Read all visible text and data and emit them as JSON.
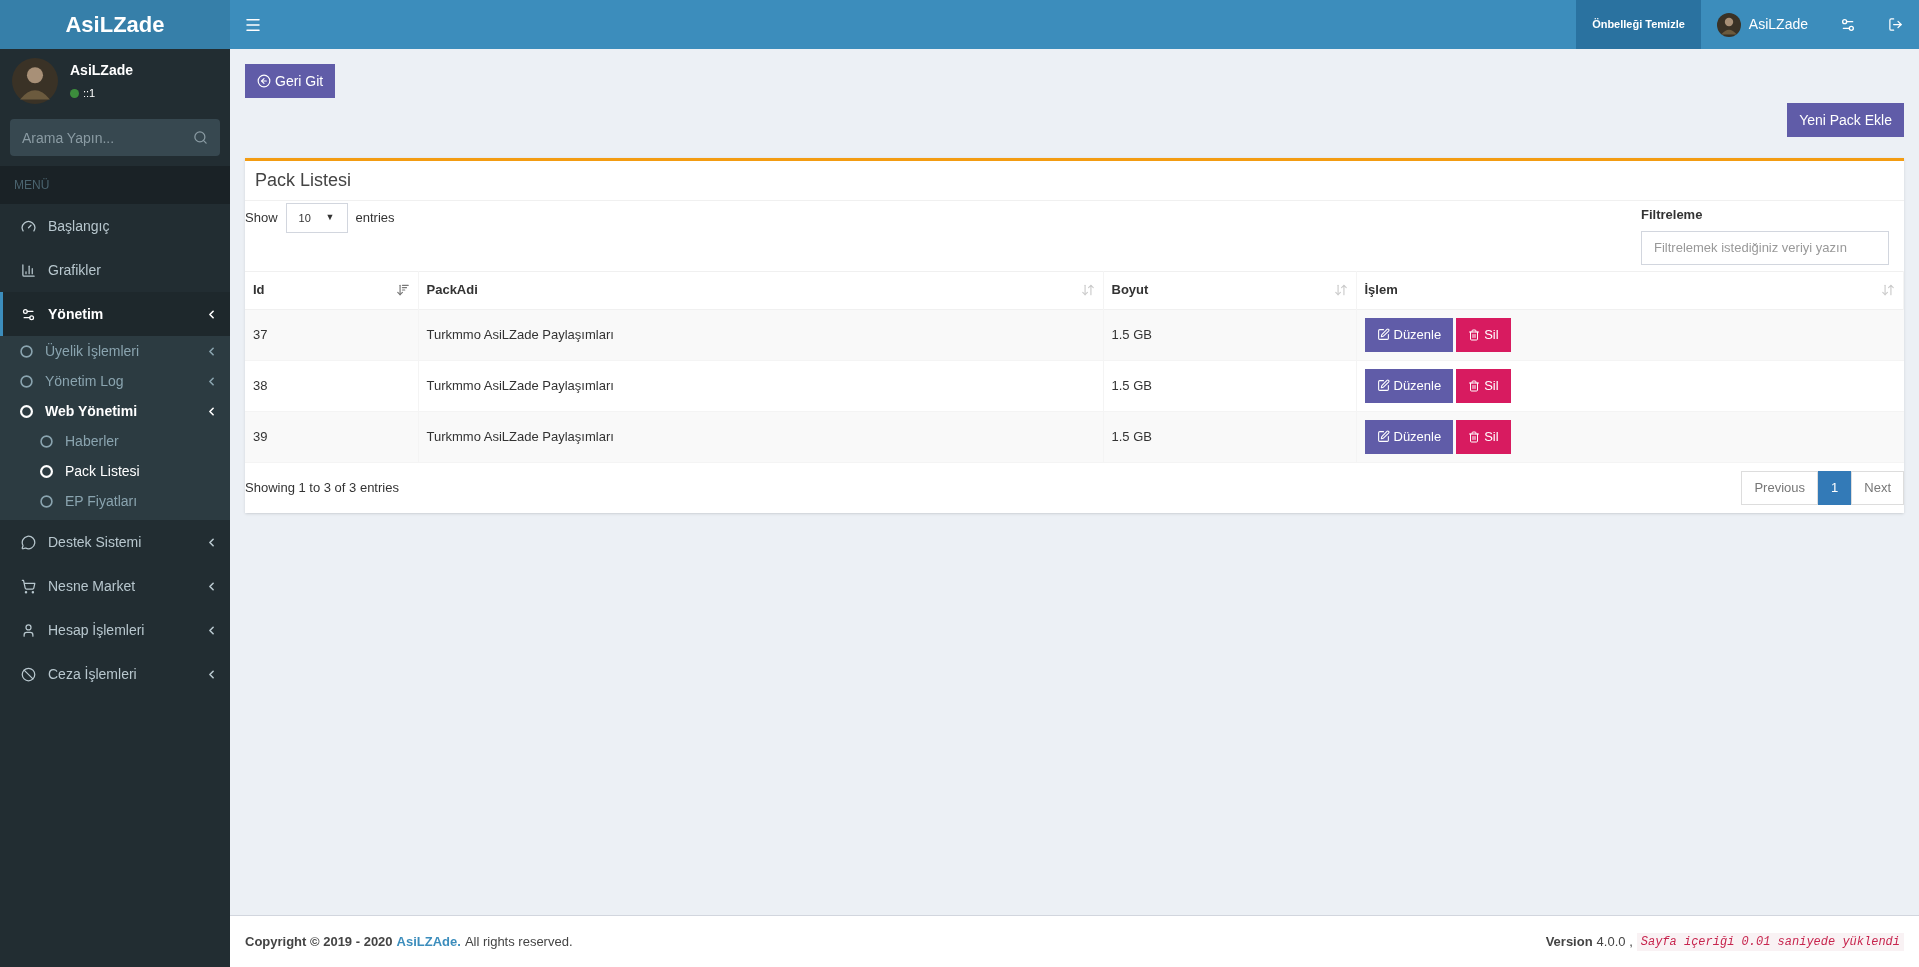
{
  "brand": "AsiLZade",
  "user_panel": {
    "name": "AsiLZade",
    "status": "::1",
    "online": true
  },
  "sidebar_search": {
    "placeholder": "Arama Yapın..."
  },
  "menu_header": "MENÜ",
  "sidebar": [
    {
      "label": "Başlangıç",
      "selected": false,
      "has_caret": false
    },
    {
      "label": "Grafikler",
      "selected": false,
      "has_caret": false
    },
    {
      "label": "Yönetim",
      "selected": true,
      "has_caret": true,
      "expanded": true,
      "children": [
        {
          "label": "Üyelik İşlemleri",
          "selected": false,
          "has_caret": true
        },
        {
          "label": "Yönetim Log",
          "selected": false,
          "has_caret": true
        },
        {
          "label": "Web Yönetimi",
          "selected": true,
          "has_caret": true,
          "expanded": true,
          "children": [
            {
              "label": "Haberler",
              "selected": false
            },
            {
              "label": "Pack Listesi",
              "selected": true
            },
            {
              "label": "EP Fiyatları",
              "selected": false
            }
          ]
        }
      ]
    },
    {
      "label": "Destek Sistemi",
      "selected": false,
      "has_caret": true
    },
    {
      "label": "Nesne Market",
      "selected": false,
      "has_caret": true
    },
    {
      "label": "Hesap İşlemleri",
      "selected": false,
      "has_caret": true
    },
    {
      "label": "Ceza İşlemleri",
      "selected": false,
      "has_caret": true
    }
  ],
  "topbar": {
    "clear_cache": "Önbelleği Temizle",
    "user": "AsiLZade"
  },
  "back_button": "Geri Git",
  "add_button": "Yeni Pack Ekle",
  "box": {
    "title": "Pack Listesi",
    "length": {
      "before": "Show",
      "value": "10",
      "arrow": "▼",
      "after": "entries"
    },
    "filter": {
      "label": "Filtreleme",
      "placeholder": "Filtrelemek istediğiniz veriyi yazın"
    },
    "columns": [
      {
        "label": "Id",
        "sorted": true
      },
      {
        "label": "PackAdi",
        "sorted": false
      },
      {
        "label": "Boyut",
        "sorted": false
      },
      {
        "label": "İşlem",
        "sorted": false
      }
    ],
    "rows": [
      {
        "id": "37",
        "name": "Turkmmo AsiLZade Paylaşımları",
        "size": "1.5 GB",
        "edit": "Düzenle",
        "delete": "Sil"
      },
      {
        "id": "38",
        "name": "Turkmmo AsiLZade Paylaşımları",
        "size": "1.5 GB",
        "edit": "Düzenle",
        "delete": "Sil"
      },
      {
        "id": "39",
        "name": "Turkmmo AsiLZade Paylaşımları",
        "size": "1.5 GB",
        "edit": "Düzenle",
        "delete": "Sil"
      }
    ],
    "info": "Showing 1 to 3 of 3 entries",
    "pagination": [
      {
        "label": "Previous",
        "selected": false
      },
      {
        "label": "1",
        "selected": true
      },
      {
        "label": "Next",
        "selected": false
      }
    ]
  },
  "footer": {
    "copyright": "**Copyright © 2019 - 2020**",
    "link": "AsiLZAde.",
    "rights": "All rights reserved.",
    "version_label": "Version",
    "version": "4.0.0 ,",
    "timing": "Sayfa içeriği 0.01 saniyede yüklendi"
  }
}
